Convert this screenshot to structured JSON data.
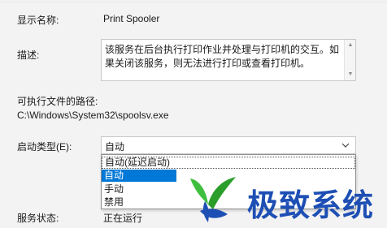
{
  "service": {
    "display_name_label": "显示名称:",
    "display_name_value": "Print Spooler",
    "description_label": "描述:",
    "description_text": "该服务在后台执行打印作业并处理与打印机的交互。如果关闭该服务，则无法进行打印或查看打印机。",
    "path_label": "可执行文件的路径:",
    "path_value": "C:\\Windows\\System32\\spoolsv.exe",
    "startup_type_label": "启动类型(E):",
    "startup_type_value": "自动",
    "startup_options": [
      "自动(延迟启动)",
      "自动",
      "手动",
      "禁用"
    ],
    "startup_selected_index": 1,
    "status_label": "服务状态:",
    "status_value": "正在运行"
  },
  "watermark": {
    "text": "极致系统"
  },
  "colors": {
    "selection": "#0078d7",
    "watermark_blue": "#1e4fb4",
    "watermark_green": "#3fbf3f"
  }
}
